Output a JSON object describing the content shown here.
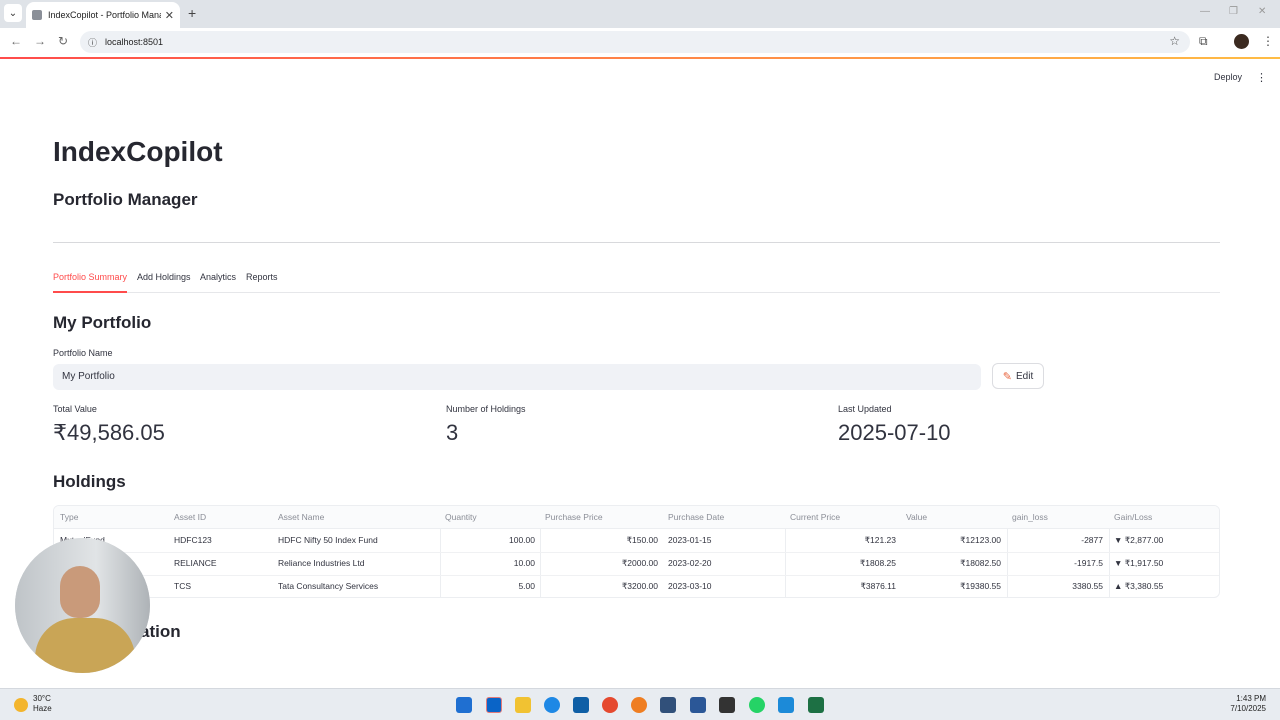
{
  "browser": {
    "tab_title": "IndexCopilot - Portfolio Manag",
    "url": "localhost:8501"
  },
  "app": {
    "deploy_label": "Deploy",
    "title": "IndexCopilot",
    "subtitle": "Portfolio Manager",
    "tabs": [
      "Portfolio Summary",
      "Add Holdings",
      "Analytics",
      "Reports"
    ],
    "active_tab": "Portfolio Summary"
  },
  "portfolio": {
    "heading": "My Portfolio",
    "name_label": "Portfolio Name",
    "name_value": "My Portfolio",
    "edit_label": "Edit",
    "metrics": [
      {
        "label": "Total Value",
        "value": "₹49,586.05"
      },
      {
        "label": "Number of Holdings",
        "value": "3"
      },
      {
        "label": "Last Updated",
        "value": "2025-07-10"
      }
    ]
  },
  "holdings": {
    "heading": "Holdings",
    "columns": [
      "Type",
      "Asset ID",
      "Asset Name",
      "Quantity",
      "Purchase Price",
      "Purchase Date",
      "Current Price",
      "Value",
      "gain_loss",
      "Gain/Loss"
    ],
    "rows": [
      [
        "MutualFund",
        "HDFC123",
        "HDFC Nifty 50 Index Fund",
        "100.00",
        "₹150.00",
        "2023-01-15",
        "₹121.23",
        "₹12123.00",
        "-2877",
        "▼ ₹2,877.00"
      ],
      [
        "",
        "RELIANCE",
        "Reliance Industries Ltd",
        "10.00",
        "₹2000.00",
        "2023-02-20",
        "₹1808.25",
        "₹18082.50",
        "-1917.5",
        "▼ ₹1,917.50"
      ],
      [
        "",
        "TCS",
        "Tata Consultancy Services",
        "5.00",
        "₹3200.00",
        "2023-03-10",
        "₹3876.11",
        "₹19380.55",
        "3380.55",
        "▲ ₹3,380.55"
      ]
    ]
  },
  "next_section_partial": "ation",
  "taskbar": {
    "weather_temp": "30°C",
    "weather_desc": "Haze",
    "time": "1:43 PM",
    "date": "7/10/2025"
  }
}
